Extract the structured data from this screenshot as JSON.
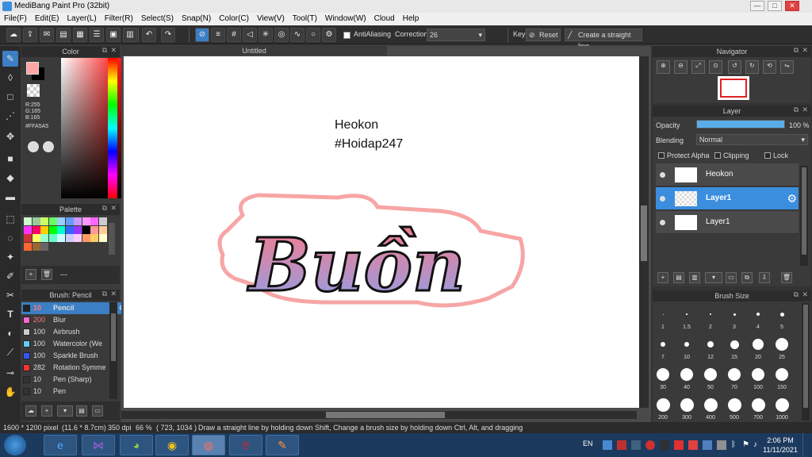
{
  "app": {
    "title": "MediBang Paint Pro (32bit)",
    "min": "—",
    "max": "□",
    "close": "✕"
  },
  "menu": [
    "File(F)",
    "Edit(E)",
    "Layer(L)",
    "Filter(R)",
    "Select(S)",
    "Snap(N)",
    "Color(C)",
    "View(V)",
    "Tool(T)",
    "Window(W)",
    "Cloud",
    "Help"
  ],
  "toolbar": {
    "antialiasing": "AntiAliasing",
    "correction_label": "Correction",
    "correction_value": "26",
    "key_label": "Key",
    "reset": "Reset",
    "straight_line": "Create a straight line"
  },
  "color_panel": {
    "title": "Color",
    "r": "R:255",
    "g": "G:165",
    "b": "B:165",
    "hex": "#FFA5A5",
    "primary": "#FFA5A5",
    "secondary": "#000000"
  },
  "palette": {
    "title": "Palette",
    "more": "---"
  },
  "brush_panel": {
    "title": "Brush: Pencil",
    "brushes": [
      {
        "size": "10",
        "name": "Pencil",
        "color": "#222222"
      },
      {
        "size": "200",
        "name": "Blur",
        "color": "#ff66cc"
      },
      {
        "size": "100",
        "name": "Airbrush",
        "color": "#cccccc"
      },
      {
        "size": "100",
        "name": "Watercolor (We",
        "color": "#66ccff"
      },
      {
        "size": "100",
        "name": "Sparkle Brush",
        "color": "#3355ff"
      },
      {
        "size": "282",
        "name": "Rotation Symme",
        "color": "#ff3333"
      },
      {
        "size": "10",
        "name": "Pen (Sharp)",
        "color": "#333333"
      },
      {
        "size": "10",
        "name": "Pen",
        "color": "#333333"
      }
    ]
  },
  "document": {
    "tab": "Untitled",
    "text1": "Heokon",
    "text2": "#Hoidap247",
    "art_text": "Buồn"
  },
  "navigator": {
    "title": "Navigator"
  },
  "layer_panel": {
    "title": "Layer",
    "opacity_label": "Opacity",
    "opacity_value": "100 %",
    "opacity_fraction": 1.0,
    "blending_label": "Blending",
    "blending_value": "Normal",
    "protect_alpha": "Protect Alpha",
    "clipping": "Clipping",
    "lock": "Lock",
    "layers": [
      {
        "name": "Heokon"
      },
      {
        "name": "Layer1"
      },
      {
        "name": "Layer1"
      }
    ]
  },
  "brush_size": {
    "title": "Brush Size",
    "sizes": [
      "1",
      "1.5",
      "2",
      "3",
      "4",
      "5",
      "7",
      "10",
      "12",
      "15",
      "20",
      "25",
      "30",
      "40",
      "50",
      "70",
      "100",
      "150",
      "200",
      "300",
      "400",
      "500",
      "700",
      "1000"
    ]
  },
  "status": {
    "dimensions": "1600 * 1200 pixel",
    "cm": "(11.6 * 8.7cm)",
    "dpi": "350 dpi",
    "zoom": "66 %",
    "coords": "( 723, 1034 )",
    "hint": "Draw a straight line by holding down Shift, Change a brush size by holding down Ctrl, Alt, and dragging"
  },
  "taskbar": {
    "lang": "EN",
    "time": "2:06 PM",
    "date": "11/11/2021"
  }
}
